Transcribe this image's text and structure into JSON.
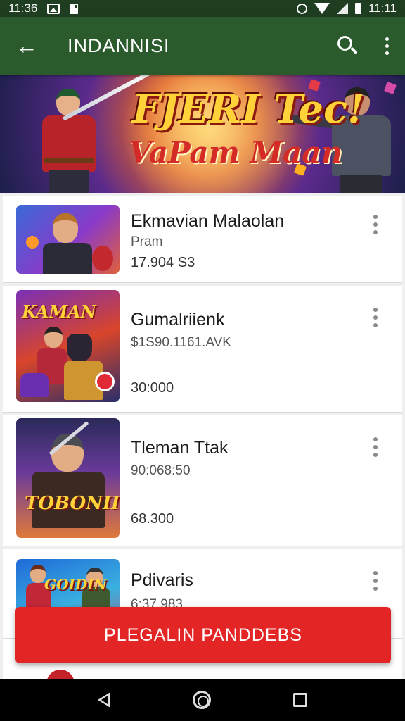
{
  "status_bar": {
    "time_left": "11:36",
    "time_right": "11:11"
  },
  "app_bar": {
    "title": "INDANNISI"
  },
  "banner": {
    "title": "FJERI Tec!",
    "subtitle": "VaPam Maan"
  },
  "items": [
    {
      "title": "Ekmavian Malaolan",
      "subtitle": "Pram",
      "count": "17.904 S3",
      "thumb_logo": ""
    },
    {
      "title": "Gumalriienk",
      "subtitle": "$1S90.1161.AVK",
      "count": "30:000",
      "thumb_logo": "KAMAN"
    },
    {
      "title": "Tleman Ttak",
      "subtitle": "90:068:50",
      "count": "68.300",
      "thumb_logo": "TOBONIIS"
    },
    {
      "title": "Pdivaris",
      "subtitle": "6:37 983",
      "count": "",
      "thumb_logo": "GOIDIN"
    }
  ],
  "cta": {
    "label": "PLEGALIN PANDDEBS"
  },
  "colors": {
    "app_bar": "#2b5a2d",
    "status_bar": "#1f3d20",
    "cta": "#e32525"
  }
}
